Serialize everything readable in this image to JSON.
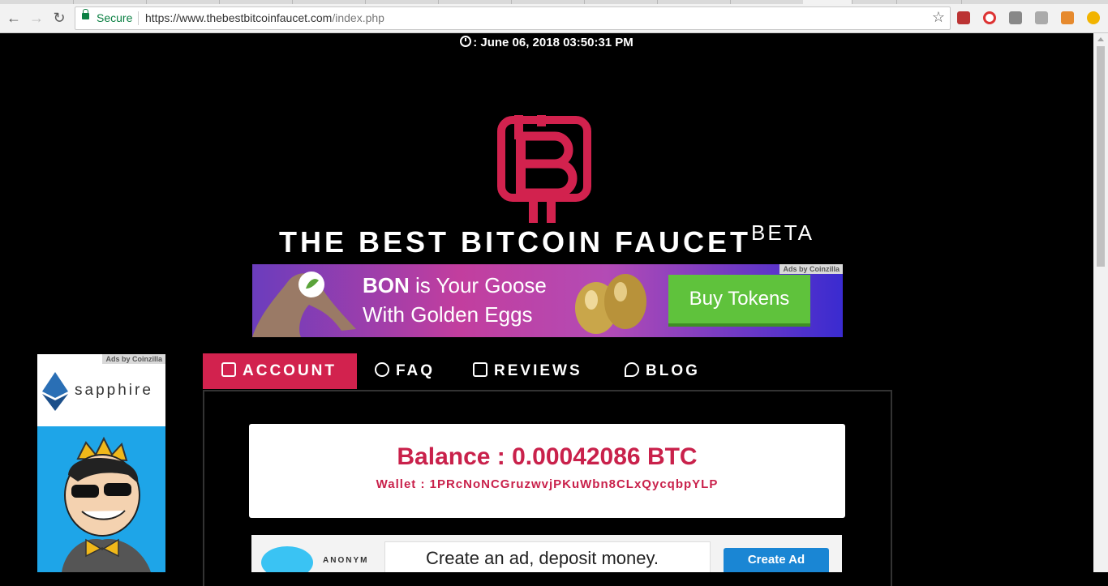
{
  "browser": {
    "secure_label": "Secure",
    "url_domain": "https://www.thebestbitcoinfaucet.com",
    "url_path": "/index.php"
  },
  "page": {
    "datetime": ": June 06, 2018 03:50:31 PM",
    "site_title": "THE BEST BITCOIN FAUCET",
    "site_title_sup": "BETA",
    "ads_label": "Ads by Coinzilla",
    "colors": {
      "accent": "#d2224e",
      "balance_text": "#c9214b"
    }
  },
  "top_banner": {
    "line1_bold": "BON",
    "line1_rest": " is Your Goose",
    "line2": "With Golden Eggs",
    "button": "Buy Tokens"
  },
  "side_ad": {
    "brand": "sapphire",
    "ads_label": "Ads by Coinzilla"
  },
  "tabs": [
    {
      "label": "ACCOUNT",
      "icon": "user-card-icon",
      "active": true
    },
    {
      "label": "FAQ",
      "icon": "question-circle-icon",
      "active": false
    },
    {
      "label": "REVIEWS",
      "icon": "edit-icon",
      "active": false
    },
    {
      "label": "BLOG",
      "icon": "comments-icon",
      "active": false
    }
  ],
  "account": {
    "balance": "Balance : 0.00042086 BTC",
    "wallet": "Wallet : 1PRcNoNCGruzwvjPKuWbn8CLxQycqbpYLP"
  },
  "bottom_ad": {
    "brand": "ANONYM",
    "message": "Create an ad, deposit money.",
    "button": "Create Ad"
  }
}
